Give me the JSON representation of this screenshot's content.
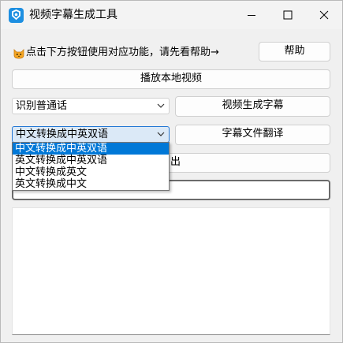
{
  "window": {
    "title": "视频字幕生成工具",
    "icons": {
      "app": "app-logo-icon",
      "minimize": "minimize-icon",
      "maximize": "maximize-icon",
      "close": "close-icon"
    }
  },
  "tip": {
    "icon": "cat-emoji-icon",
    "text": "点击下方按钮使用对应功能，请先看帮助→"
  },
  "buttons": {
    "help": "帮助",
    "play_local_video": "播放本地视频",
    "generate_subtitles": "视频生成字幕",
    "translate_subtitle_file": "字幕文件翻译",
    "partially_hidden_label": "出"
  },
  "speech_combo": {
    "selected": "识别普通话"
  },
  "translate_combo": {
    "selected": "中文转换成中英双语",
    "options": [
      "中文转换成中英双语",
      "英文转换成中英双语",
      "中文转换成英文",
      "英文转换成中文"
    ],
    "selected_index": 0
  },
  "colors": {
    "selection": "#0078d7",
    "open_combo_bg": "#dbe9f7",
    "app_icon": "#1d8fe1"
  }
}
